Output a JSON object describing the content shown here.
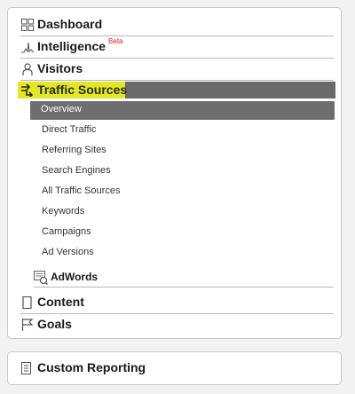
{
  "nav": {
    "dashboard": "Dashboard",
    "intelligence": "Intelligence",
    "intelligence_badge": "Beta",
    "visitors": "Visitors",
    "traffic_sources": "Traffic Sources",
    "content": "Content",
    "goals": "Goals"
  },
  "traffic_sources_items": [
    "Overview",
    "Direct Traffic",
    "Referring Sites",
    "Search Engines",
    "All Traffic Sources",
    "Keywords",
    "Campaigns",
    "Ad Versions"
  ],
  "adwords": "AdWords",
  "custom_reporting": "Custom Reporting",
  "icons": {
    "dashboard": "grid-icon",
    "intelligence": "sparkline-icon",
    "visitors": "person-icon",
    "traffic_sources": "arrows-icon",
    "adwords": "adwords-icon",
    "content": "page-icon",
    "goals": "flag-icon",
    "custom_reporting": "document-icon"
  },
  "colors": {
    "highlight": "#f1f51e",
    "active_bg": "#6a6a6a",
    "beta": "#e02020"
  }
}
